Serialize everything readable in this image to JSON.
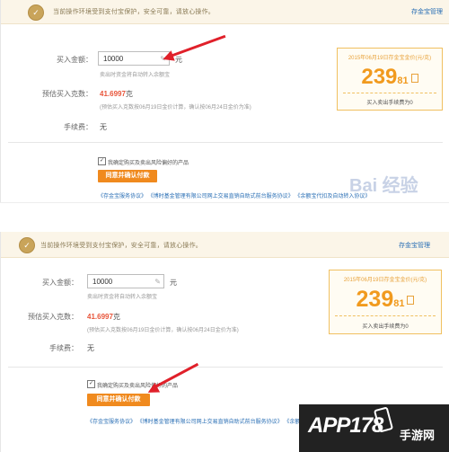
{
  "notice": "当前操作环境受到支付宝保护，安全可靠，请放心操作。",
  "top_link": "存金宝管理",
  "labels": {
    "amount": "买入金额：",
    "estimate": "预估买入克数：",
    "fee": "手续费："
  },
  "amount_value": "10000",
  "amount_unit": "元",
  "amount_hint": "卖出时资金将自动转入余额宝",
  "estimate_value": "41.6997",
  "estimate_unit": "克",
  "estimate_hint": "(预估买入克数按06月19日金价计算，确认按06月24日金价为准)",
  "fee_value": "无",
  "pricebox": {
    "title": "2015年06月19日存金宝金价(元/克)",
    "int": "239",
    "dec": "81",
    "foot": "买入卖出手续费为0"
  },
  "agree_label": "我确定购买及卖出风险偏好的产品",
  "pay_button": "同意并确认付款",
  "agreements": "《存金宝服务协议》 《博时基金管理有限公司网上交易直销自助式前台服务协议》 《余额宝代扣及自动转入协议》",
  "watermark": "Bai 经验",
  "logo": {
    "main": "APP178",
    "sub": "手游网"
  }
}
